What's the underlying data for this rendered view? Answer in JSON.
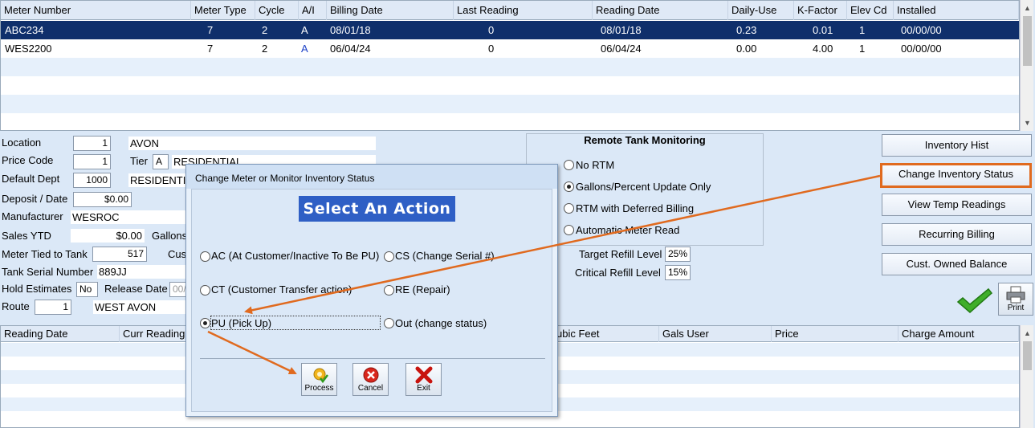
{
  "meter_grid": {
    "headers": [
      "Meter Number",
      "Meter Type",
      "Cycle",
      "A/I",
      "Billing Date",
      "Last Reading",
      "Reading Date",
      "Daily-Use",
      "K-Factor",
      "Elev Cd",
      "Installed"
    ],
    "rows": [
      [
        "ABC234",
        "7",
        "2",
        "A",
        "08/01/18",
        "0",
        "08/01/18",
        "0.23",
        "0.01",
        "1",
        "00/00/00"
      ],
      [
        "WES2200",
        "7",
        "2",
        "A",
        "06/04/24",
        "0",
        "06/04/24",
        "0.00",
        "4.00",
        "1",
        "00/00/00"
      ]
    ]
  },
  "form": {
    "location_label": "Location",
    "location_code": "1",
    "location_name": "AVON",
    "price_code_label": "Price Code",
    "price_code": "1",
    "tier_label": "Tier",
    "tier": "A",
    "tier_name": "RESIDENTIAL",
    "default_dept_label": "Default Dept",
    "default_dept": "1000",
    "default_dept_name": "RESIDENTIA",
    "deposit_label": "Deposit / Date",
    "deposit": "$0.00",
    "manufacturer_label": "Manufacturer",
    "manufacturer": "WESROC",
    "sales_ytd_label": "Sales YTD",
    "sales_ytd": "$0.00",
    "gallons_label": "Gallons",
    "meter_tied_label": "Meter Tied to Tank",
    "meter_tied": "517",
    "cust_label": "Cus",
    "tank_serial_label": "Tank Serial Number",
    "tank_serial": "889JJ",
    "hold_estimates_label": "Hold Estimates",
    "hold_estimates": "No",
    "release_date_label": "Release Date",
    "release_date": "00/",
    "route_label": "Route",
    "route": "1",
    "route_name": "WEST AVON"
  },
  "rtm": {
    "title": "Remote Tank Monitoring",
    "options": [
      "No RTM",
      "Gallons/Percent Update Only",
      "RTM with Deferred Billing",
      "Automatic Meter Read"
    ],
    "selected_index": 1,
    "target_refill_label": "Target Refill Level",
    "target_refill": "25%",
    "critical_refill_label": "Critical Refill Level",
    "critical_refill": "15%"
  },
  "side_buttons": [
    "Inventory Hist",
    "Change Inventory Status",
    "View Temp Readings",
    "Recurring Billing",
    "Cust. Owned Balance"
  ],
  "print_label": "Print",
  "reading_grid": {
    "headers_left": [
      "Reading Date",
      "Curr Reading"
    ],
    "headers_right": [
      "ubic Feet",
      "Gals User",
      "Price",
      "Charge Amount"
    ]
  },
  "dialog": {
    "title": "Change Meter or Monitor Inventory Status",
    "banner": "Select An Action",
    "options": [
      "AC (At Customer/Inactive To Be PU)",
      "CS (Change Serial #)",
      "CT (Customer Transfer action)",
      "RE (Repair)",
      "PU (Pick Up)",
      "Out (change status)"
    ],
    "selected_index": 4,
    "buttons": [
      "Process",
      "Cancel",
      "Exit"
    ]
  },
  "colors": {
    "highlight": "#e06a1f",
    "selected_row": "#0f2f6b",
    "banner": "#2f5fc5"
  }
}
